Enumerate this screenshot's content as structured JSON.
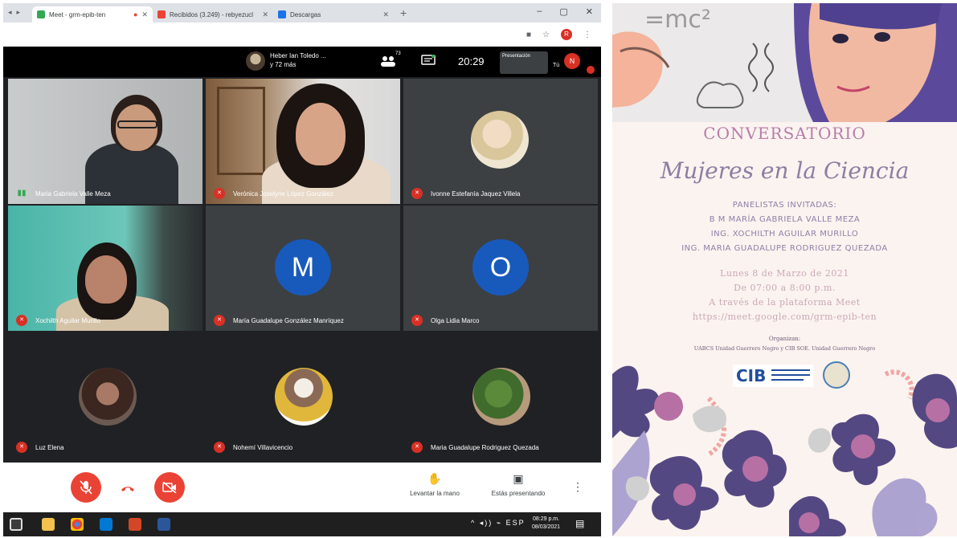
{
  "browser": {
    "tabs": [
      {
        "title": "Meet - grm-epib-ten",
        "favicon_color": "#34a853",
        "active": true
      },
      {
        "title": "Recibidos (3.249) - rebyezucl",
        "favicon_color": "#ea4335",
        "active": false
      },
      {
        "title": "Descargas",
        "favicon_color": "#1a73e8",
        "active": false
      }
    ],
    "new_tab": "+",
    "window_controls": [
      "–",
      "▢",
      "✕"
    ],
    "profile_initial": "R"
  },
  "meet_header": {
    "participants_text": "Heber Ian Toledo ...",
    "participants_more": "y 72 más",
    "people_count": "73",
    "clock": "20:29",
    "presenter_label": "Presentación",
    "you_label": "Tú",
    "self_initial": "N"
  },
  "tiles": [
    {
      "name": "Maria Gabriela Valle Meza",
      "type": "video",
      "mic_on": true
    },
    {
      "name": "Verónica Joselyne López González",
      "type": "video",
      "mic_on": false
    },
    {
      "name": "Ivonne Estefanía Jaquez Villela",
      "type": "photo",
      "mic_on": false
    },
    {
      "name": "Xochilth Aguilar Murillo",
      "type": "video",
      "mic_on": false
    },
    {
      "name": "María Guadalupe González Manríquez",
      "type": "initial",
      "initial": "M",
      "mic_on": false
    },
    {
      "name": "Olga Lidia Marco",
      "type": "initial",
      "initial": "O",
      "mic_on": false
    },
    {
      "name": "Luz Elena",
      "type": "photo",
      "mic_on": false
    },
    {
      "name": "Nohemí Villavicencio",
      "type": "photo",
      "mic_on": false
    },
    {
      "name": "Maria Guadalupe Rodriguez Quezada",
      "type": "photo",
      "mic_on": false
    }
  ],
  "controls": {
    "raise_hand_label": "Levantar la mano",
    "presenting_label": "Estás presentando",
    "more_label": "⋮"
  },
  "taskbar": {
    "time": "08:29 p.m.",
    "date": "08/03/2021"
  },
  "poster": {
    "title": "CONVERSATORIO",
    "script_title": "Mujeres en la Ciencia",
    "panelists_label": "PANELISTAS INVITADAS:",
    "panelists": [
      "B M MARÍA GABRIELA VALLE MEZA",
      "ING. XOCHILTH AGUILAR MURILLO",
      "ING. MARIA GUADALUPE RODRIGUEZ QUEZADA"
    ],
    "date_line": "Lunes 8 de Marzo de 2021",
    "time_line": "De 07:00 a 8:00 p.m.",
    "platform_line": "A través de la plataforma Meet",
    "url_line": "https://meet.google.com/grm-epib-ten",
    "organizers_label": "Organizan:",
    "organizers_text": "UABCS Unidad Guerrero Negro y CIB SOE. Unidad Guerrero Negro",
    "top_formula": "=mc²",
    "logo_text": "CIB"
  }
}
